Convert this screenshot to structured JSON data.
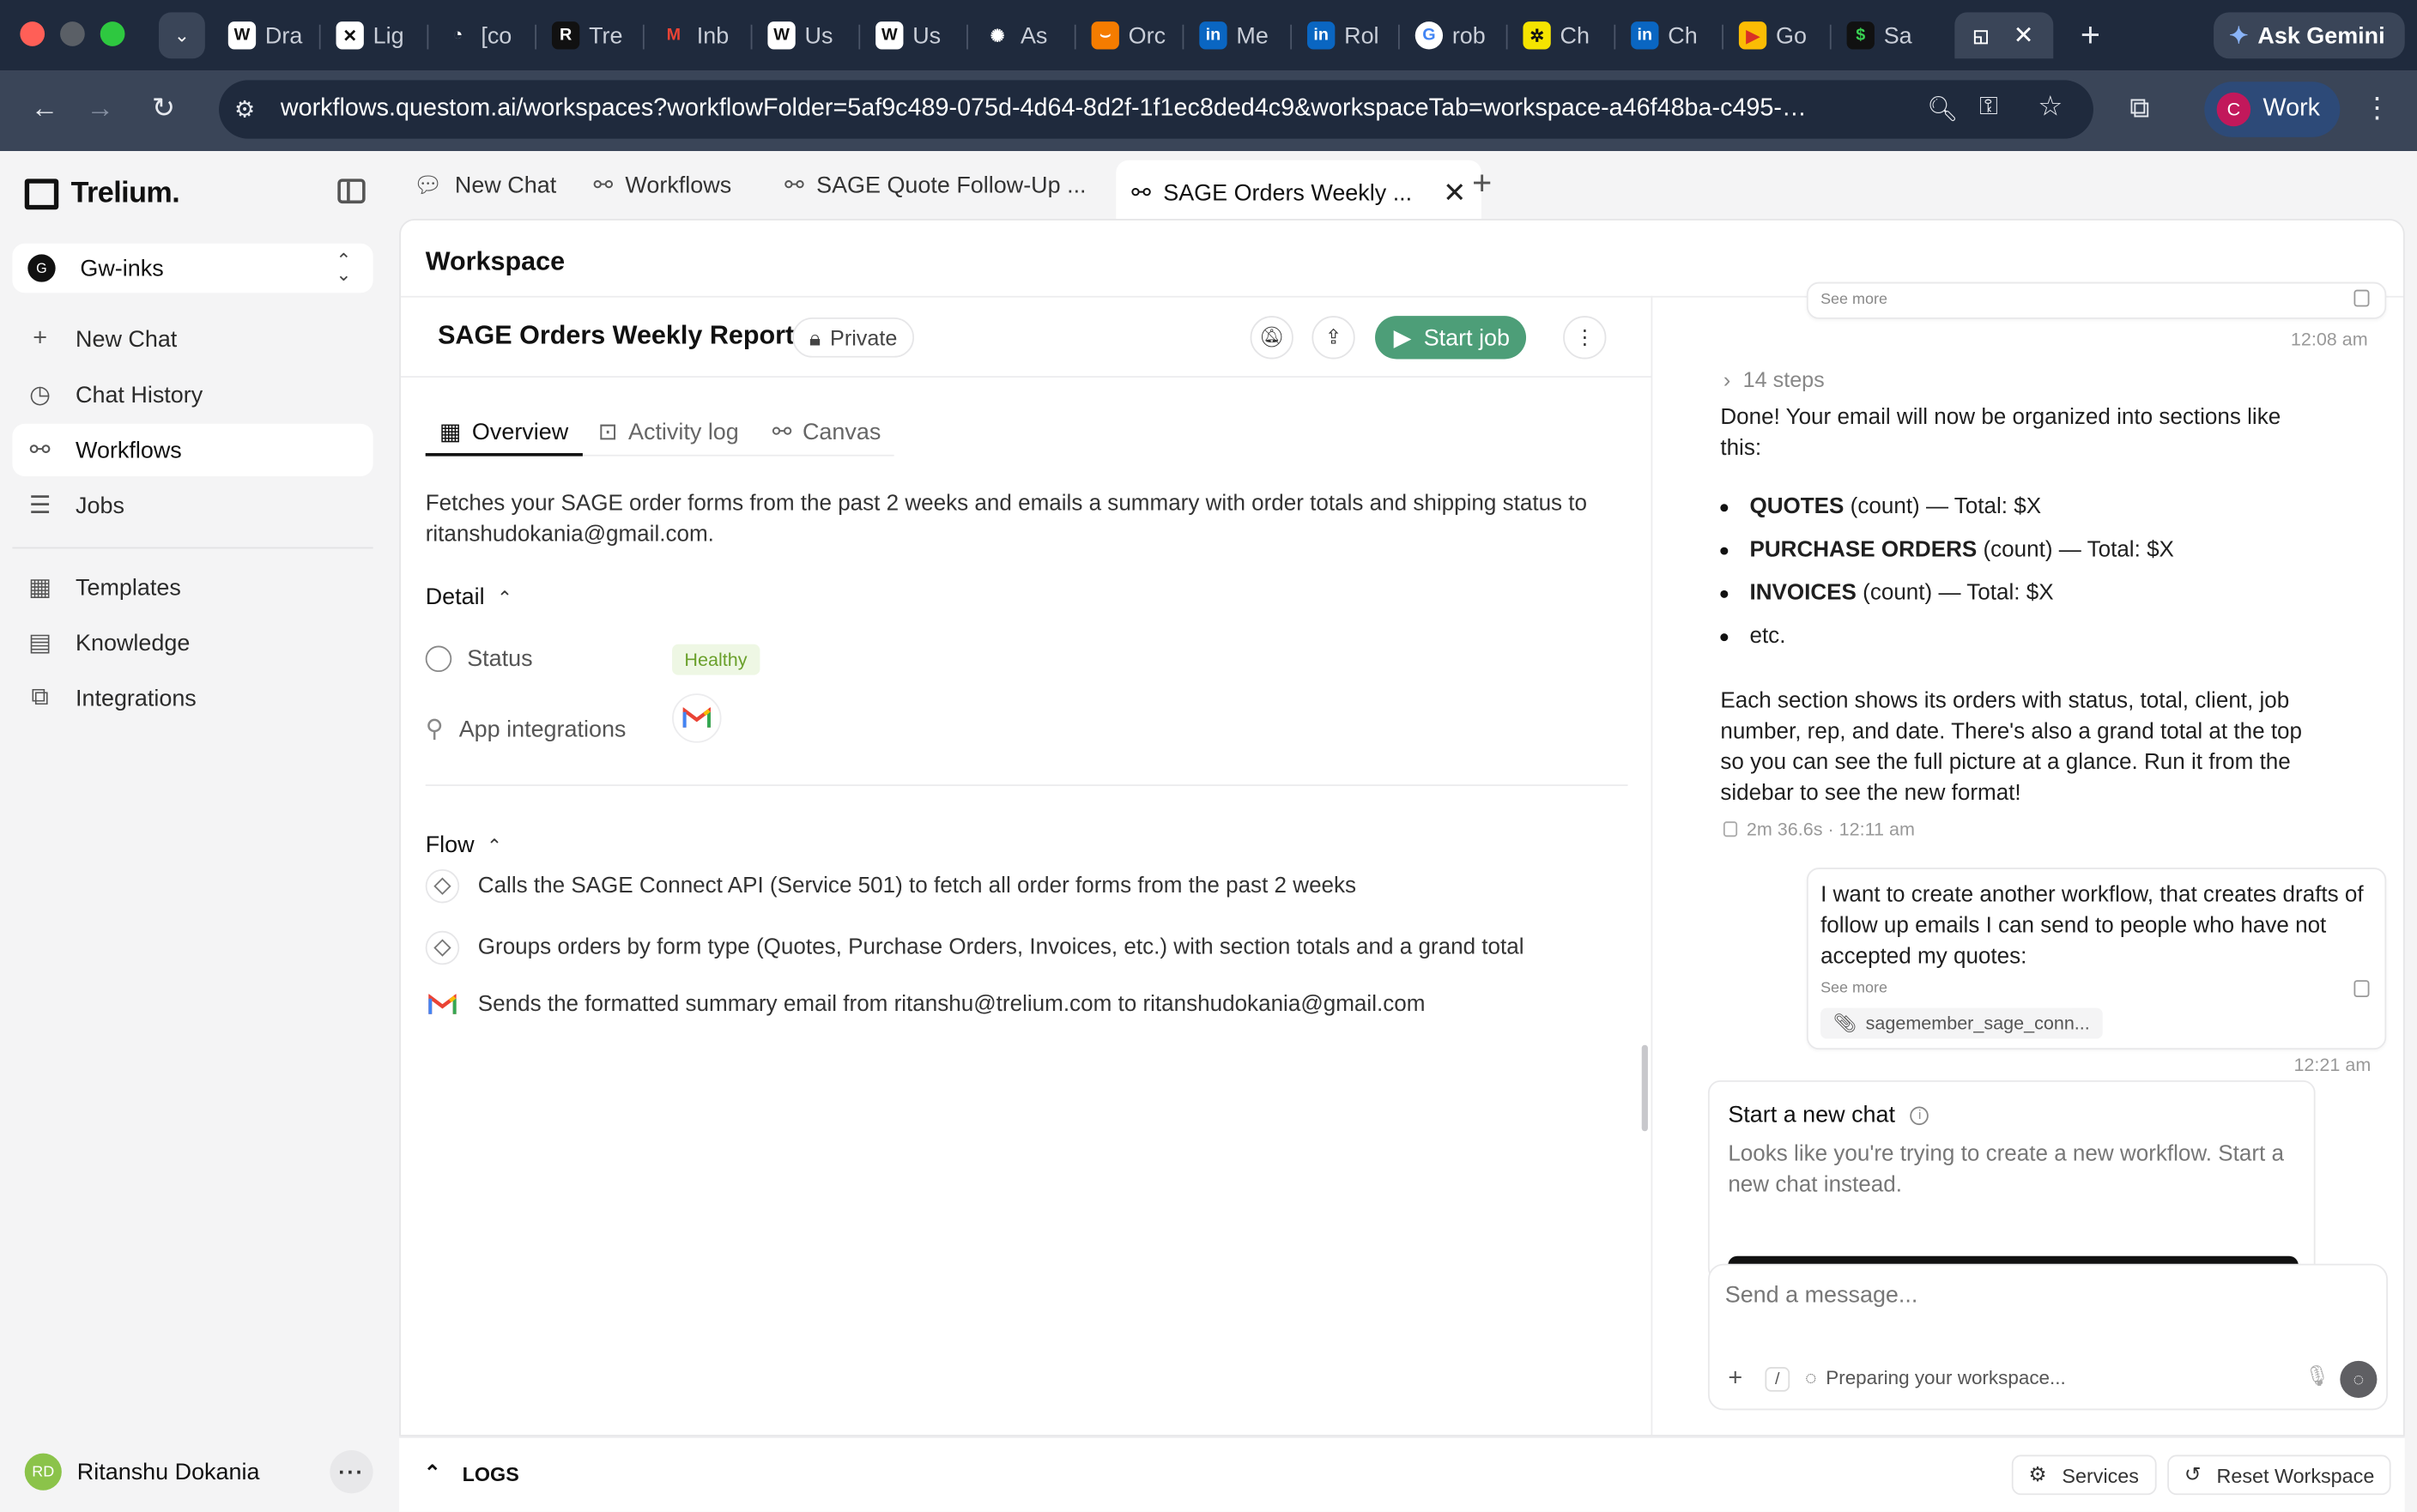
{
  "browser": {
    "tabs": [
      {
        "label": "Dra",
        "favicon": "W"
      },
      {
        "label": "Lig",
        "favicon": "✕"
      },
      {
        "label": "[co",
        "favicon": "◔"
      },
      {
        "label": "Tre",
        "favicon": "R"
      },
      {
        "label": "Inb",
        "favicon": "M"
      },
      {
        "label": "Us",
        "favicon": "W"
      },
      {
        "label": "Us",
        "favicon": "W"
      },
      {
        "label": "As",
        "favicon": "✺"
      },
      {
        "label": "Orc",
        "favicon": "⌣"
      },
      {
        "label": "Me",
        "favicon": "in"
      },
      {
        "label": "Rol",
        "favicon": "in"
      },
      {
        "label": "rob",
        "favicon": "G"
      },
      {
        "label": "Ch",
        "favicon": "✲"
      },
      {
        "label": "Ch",
        "favicon": "in"
      },
      {
        "label": "Go",
        "favicon": "▶"
      },
      {
        "label": "Sa",
        "favicon": "$"
      }
    ],
    "active_tab_favicon": "◱",
    "ask_gemini": "Ask Gemini",
    "url": "workflows.questom.ai/workspaces?workflowFolder=5af9c489-075d-4d64-8d2f-1f1ec8ded4c9&workspaceTab=workspace-a46f48ba-c495-…",
    "profile_initial": "C",
    "profile_label": "Work"
  },
  "sidebar": {
    "brand": "Trelium.",
    "workspace_initial": "G",
    "workspace_name": "Gw-inks",
    "nav": [
      {
        "label": "New Chat",
        "icon": "+"
      },
      {
        "label": "Chat History",
        "icon": "◷"
      },
      {
        "label": "Workflows",
        "icon": "⚯"
      },
      {
        "label": "Jobs",
        "icon": "☰"
      }
    ],
    "nav2": [
      {
        "label": "Templates",
        "icon": "▦"
      },
      {
        "label": "Knowledge",
        "icon": "▤"
      },
      {
        "label": "Integrations",
        "icon": "⧉"
      }
    ],
    "user_initials": "RD",
    "user_name": "Ritanshu Dokania"
  },
  "app_tabs": {
    "new_chat": "New Chat",
    "workflows": "Workflows",
    "tab3": "SAGE Quote Follow-Up ...",
    "tab4": "SAGE Orders Weekly ..."
  },
  "workspace": {
    "title": "Workspace",
    "workflow_title": "SAGE Orders Weekly Report",
    "privacy": "Private",
    "start_job": "Start job",
    "subtabs": [
      "Overview",
      "Activity log",
      "Canvas"
    ],
    "description": "Fetches your SAGE order forms from the past 2 weeks and emails a summary with order totals and shipping status to ritanshudokania@gmail.com.",
    "detail_heading": "Detail",
    "status_label": "Status",
    "status_value": "Healthy",
    "app_integrations_label": "App integrations",
    "flow_heading": "Flow",
    "flow": [
      "Calls the SAGE Connect API (Service 501) to fetch all order forms from the past 2 weeks",
      "Groups orders by form type (Quotes, Purchase Orders, Invoices, etc.) with section totals and a grand total",
      "Sends the formatted summary email from ritanshu@trelium.com to ritanshudokania@gmail.com"
    ]
  },
  "chat": {
    "prev_see_more": "See more",
    "time1": "12:08 am",
    "steps": "14 steps",
    "ai_intro": "Done! Your email will now be organized into sections like this:",
    "bullets": [
      {
        "bold": "QUOTES",
        "rest": " (count) — Total: $X"
      },
      {
        "bold": "PURCHASE ORDERS",
        "rest": " (count) — Total: $X"
      },
      {
        "bold": "INVOICES",
        "rest": " (count) — Total: $X"
      },
      {
        "bold": "",
        "rest": "etc."
      }
    ],
    "ai_outro": "Each section shows its orders with status, total, client, job number, rep, and date. There's also a grand total at the top so you can see the full picture at a glance. Run it from the sidebar to see the new format!",
    "ai_meta": "2m 36.6s · 12:11 am",
    "user_msg": "I want to create another workflow, that creates drafts of follow up emails I can send to people who have not accepted my quotes:",
    "user_see_more": "See more",
    "attachment": "sagemember_sage_conn...",
    "time2": "12:21 am",
    "new_chat_title": "Start a new chat",
    "new_chat_desc": "Looks like you're trying to create a new workflow. Start a new chat instead.",
    "composer_placeholder": "Send a message...",
    "composer_status": "Preparing your workspace..."
  },
  "logsbar": {
    "logs": "LOGS",
    "services": "Services",
    "reset": "Reset Workspace"
  }
}
